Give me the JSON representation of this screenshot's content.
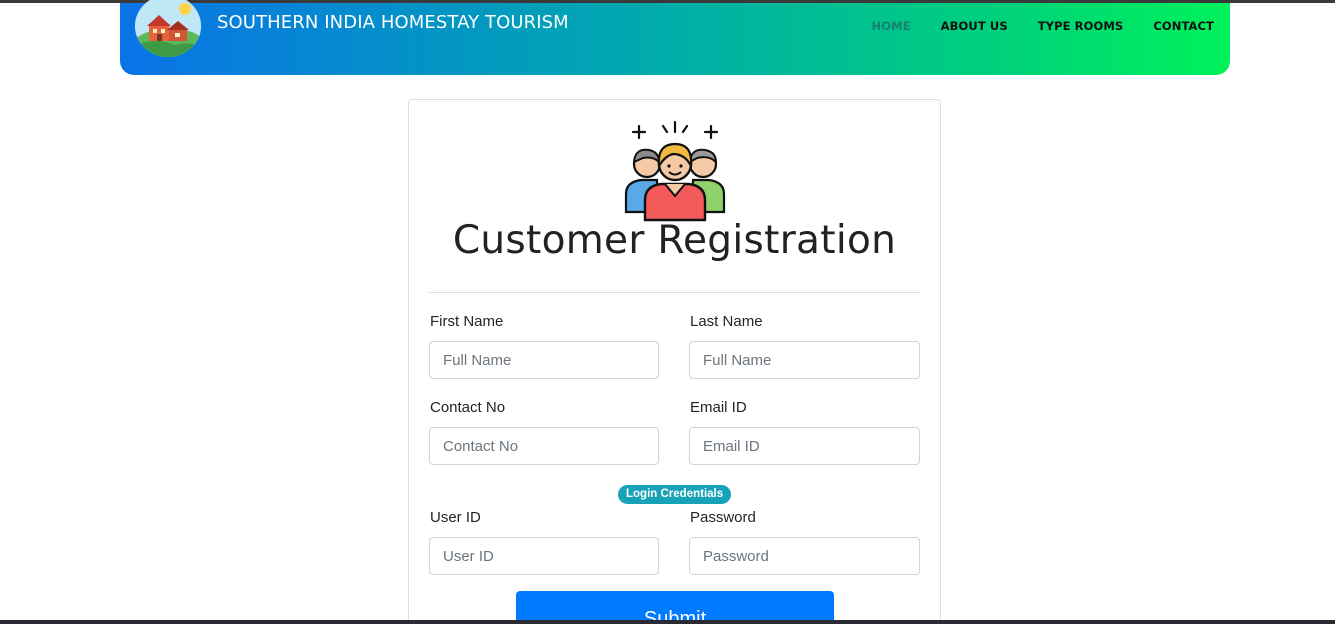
{
  "header": {
    "brand_title": "SOUTHERN INDIA HOMESTAY TOURISM",
    "nav": [
      {
        "label": "HOME",
        "active": true
      },
      {
        "label": "ABOUT US",
        "active": false
      },
      {
        "label": "TYPE ROOMS",
        "active": false
      },
      {
        "label": "CONTACT",
        "active": false
      }
    ],
    "gradient_colors": [
      "#0a73e8",
      "#00a7b0",
      "#00f25a"
    ]
  },
  "form": {
    "title": "Customer Registration",
    "hero_icon": "group-of-people-icon",
    "fields": {
      "first_name": {
        "label": "First Name",
        "placeholder": "Full Name"
      },
      "last_name": {
        "label": "Last Name",
        "placeholder": "Full Name"
      },
      "contact": {
        "label": "Contact No",
        "placeholder": "Contact No"
      },
      "email": {
        "label": "Email ID",
        "placeholder": "Email ID"
      },
      "user_id": {
        "label": "User ID",
        "placeholder": "User ID"
      },
      "password": {
        "label": "Password",
        "placeholder": "Password"
      }
    },
    "credentials_badge": "Login Credentials",
    "submit_label": "Submit",
    "accent_color": "#007bff",
    "badge_color": "#17a2b8"
  }
}
